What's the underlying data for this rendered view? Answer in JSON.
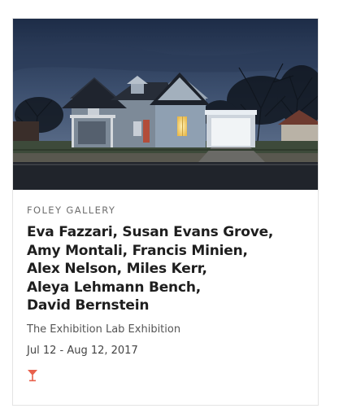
{
  "card": {
    "gallery": "FOLEY GALLERY",
    "artists_lines": [
      "Eva Fazzari, Susan Evans Grove,",
      "Amy Montali, Francis Minien,",
      "Alex Nelson, Miles Kerr,",
      "Aleya Lehmann Bench,",
      "David Bernstein"
    ],
    "title": "The Exhibition Lab Exhibition",
    "dates": "Jul 12 - Aug 12, 2017",
    "icon": "cocktail-glass-icon",
    "accent_color": "#e8604c"
  }
}
